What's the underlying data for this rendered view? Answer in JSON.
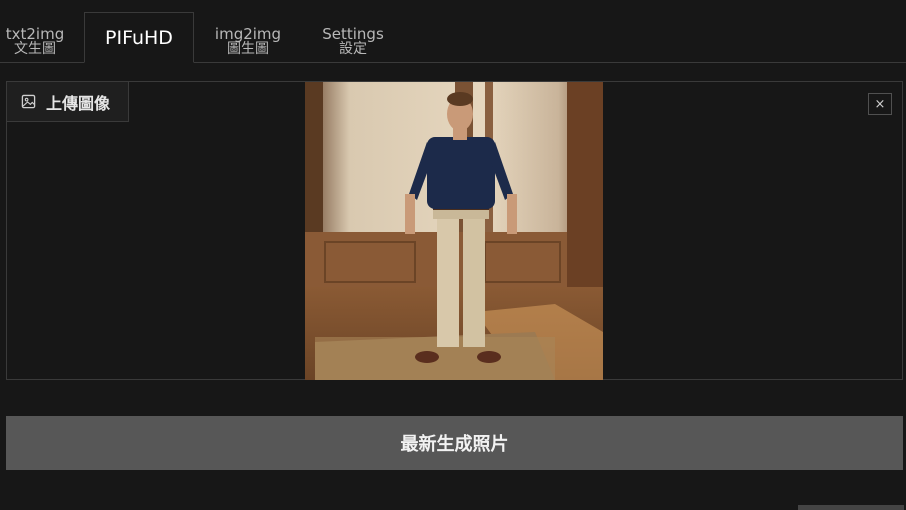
{
  "tabs": [
    {
      "line1": "txt2img",
      "line2": "文生圖"
    },
    {
      "label": "PIFuHD"
    },
    {
      "line1": "img2img",
      "line2": "圖生圖"
    },
    {
      "line1": "Settings",
      "line2": "設定"
    }
  ],
  "upload": {
    "label": "上傳圖像",
    "icon": "image-icon",
    "close_symbol": "×",
    "image_alt": "man-standing-full-body-photo"
  },
  "actions": {
    "generate_label": "最新生成照片"
  },
  "colors": {
    "background": "#171717",
    "button": "#575757",
    "border": "#3a3a3a"
  }
}
